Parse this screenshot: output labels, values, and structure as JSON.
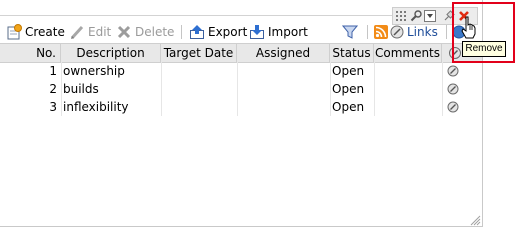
{
  "toolbar": {
    "create_label": "Create",
    "edit_label": "Edit",
    "delete_label": "Delete",
    "export_label": "Export",
    "import_label": "Import",
    "links_label": "Links"
  },
  "table": {
    "columns": [
      "No.",
      "Description",
      "Target Date",
      "Assigned",
      "Status",
      "Comments"
    ],
    "rows": [
      {
        "no": "1",
        "description": "ownership",
        "target_date": "",
        "assigned": "",
        "status": "Open",
        "comments": ""
      },
      {
        "no": "2",
        "description": "builds",
        "target_date": "",
        "assigned": "",
        "status": "Open",
        "comments": ""
      },
      {
        "no": "3",
        "description": "inflexibility",
        "target_date": "",
        "assigned": "",
        "status": "Open",
        "comments": ""
      }
    ]
  },
  "tooltip": {
    "text": "Remove"
  },
  "icons": {
    "create": "create-icon",
    "edit": "pencil-icon",
    "delete": "delete-x-icon",
    "export": "export-icon",
    "import": "import-icon",
    "filter": "filter-funnel-icon",
    "rss": "rss-icon",
    "links": "link-icon",
    "row_link": "link-icon",
    "portlet_drag": "drag-grip-icon",
    "portlet_settings": "wrench-icon",
    "portlet_menu": "dropdown-icon",
    "portlet_pin": "pin-icon",
    "portlet_remove": "close-icon",
    "cursor": "hand-cursor-icon"
  },
  "colors": {
    "highlight_border": "#e2001a",
    "tooltip_bg": "#ffffe1",
    "links_text": "#1f4d99",
    "header_bg": "#e8e8e8"
  }
}
